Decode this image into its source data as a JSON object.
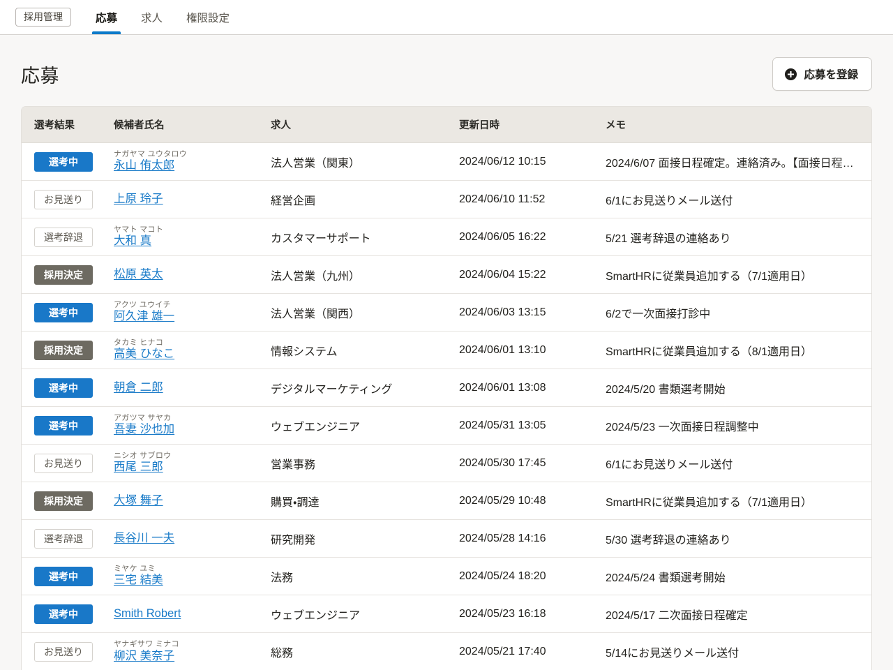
{
  "nav": {
    "app_label": "採用管理",
    "tabs": [
      {
        "label": "応募",
        "active": true
      },
      {
        "label": "求人",
        "active": false
      },
      {
        "label": "権限設定",
        "active": false
      }
    ],
    "active_tab_color": "#0c7ac9"
  },
  "header": {
    "title": "応募",
    "register_button": {
      "label": "応募を登録",
      "icon": "plus-circle-icon"
    }
  },
  "table": {
    "columns": [
      "選考結果",
      "候補者氏名",
      "求人",
      "更新日時",
      "メモ"
    ],
    "badge_colors": {
      "blue": "#1978c8",
      "grey": "#6d6a61",
      "outline_border": "#d5d2cd",
      "outline_text": "#5e5a52"
    },
    "link_color": "#1a7bc8",
    "rows": [
      {
        "result": "選考中",
        "result_style": "blue",
        "furigana": "ナガヤマ ユウタロウ",
        "name": "永山 侑太郎",
        "job": "法人営業（関東）",
        "updated_at": "2024/06/12 10:15",
        "memo": "2024/6/07 面接日程確定。連絡済み。【面接日程】…"
      },
      {
        "result": "お見送り",
        "result_style": "outline",
        "furigana": "",
        "name": "上原 玲子",
        "job": "経営企画",
        "updated_at": "2024/06/10 11:52",
        "memo": "6/1にお見送りメール送付"
      },
      {
        "result": "選考辞退",
        "result_style": "outline",
        "furigana": "ヤマト マコト",
        "name": "大和 真",
        "job": "カスタマーサポート",
        "updated_at": "2024/06/05 16:22",
        "memo": "5/21 選考辞退の連絡あり"
      },
      {
        "result": "採用決定",
        "result_style": "grey",
        "furigana": "",
        "name": "松原 英太",
        "job": "法人営業（九州）",
        "updated_at": "2024/06/04 15:22",
        "memo": "SmartHRに従業員追加する（7/1適用日）"
      },
      {
        "result": "選考中",
        "result_style": "blue",
        "furigana": "アクツ ユウイチ",
        "name": "阿久津 雄一",
        "job": "法人営業（関西）",
        "updated_at": "2024/06/03 13:15",
        "memo": "6/2で一次面接打診中"
      },
      {
        "result": "採用決定",
        "result_style": "grey",
        "furigana": "タカミ ヒナコ",
        "name": "高美 ひなこ",
        "job": "情報システム",
        "updated_at": "2024/06/01 13:10",
        "memo": "SmartHRに従業員追加する（8/1適用日）"
      },
      {
        "result": "選考中",
        "result_style": "blue",
        "furigana": "",
        "name": "朝倉 二郎",
        "job": "デジタルマーケティング",
        "updated_at": "2024/06/01 13:08",
        "memo": "2024/5/20 書類選考開始"
      },
      {
        "result": "選考中",
        "result_style": "blue",
        "furigana": "アガツマ サヤカ",
        "name": "吾妻 沙也加",
        "job": "ウェブエンジニア",
        "updated_at": "2024/05/31 13:05",
        "memo": "2024/5/23 一次面接日程調整中"
      },
      {
        "result": "お見送り",
        "result_style": "outline",
        "furigana": "ニシオ サブロウ",
        "name": "西尾 三郎",
        "job": "営業事務",
        "updated_at": "2024/05/30 17:45",
        "memo": "6/1にお見送りメール送付"
      },
      {
        "result": "採用決定",
        "result_style": "grey",
        "furigana": "",
        "name": "大塚 舞子",
        "job": "購買・調達",
        "updated_at": "2024/05/29 10:48",
        "memo": "SmartHRに従業員追加する（7/1適用日）"
      },
      {
        "result": "選考辞退",
        "result_style": "outline",
        "furigana": "",
        "name": "長谷川 一夫",
        "job": "研究開発",
        "updated_at": "2024/05/28 14:16",
        "memo": "5/30 選考辞退の連絡あり"
      },
      {
        "result": "選考中",
        "result_style": "blue",
        "furigana": "ミヤケ ユミ",
        "name": "三宅 結美",
        "job": "法務",
        "updated_at": "2024/05/24 18:20",
        "memo": "2024/5/24 書類選考開始"
      },
      {
        "result": "選考中",
        "result_style": "blue",
        "furigana": "",
        "name": "Smith Robert",
        "job": "ウェブエンジニア",
        "updated_at": "2024/05/23 16:18",
        "memo": "2024/5/17 二次面接日程確定"
      },
      {
        "result": "お見送り",
        "result_style": "outline",
        "furigana": "ヤナギサワ ミナコ",
        "name": "柳沢 美奈子",
        "job": "総務",
        "updated_at": "2024/05/21 17:40",
        "memo": "5/14にお見送りメール送付"
      }
    ]
  }
}
